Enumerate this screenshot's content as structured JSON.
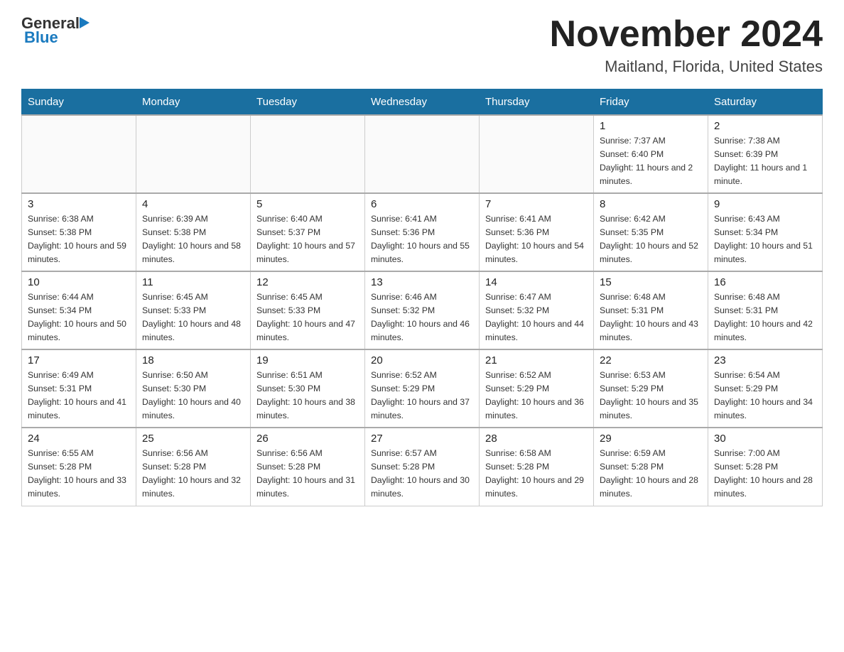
{
  "header": {
    "logo_general": "General",
    "logo_blue": "Blue",
    "month_title": "November 2024",
    "location": "Maitland, Florida, United States"
  },
  "days_of_week": [
    "Sunday",
    "Monday",
    "Tuesday",
    "Wednesday",
    "Thursday",
    "Friday",
    "Saturday"
  ],
  "weeks": [
    {
      "days": [
        {
          "num": "",
          "info": ""
        },
        {
          "num": "",
          "info": ""
        },
        {
          "num": "",
          "info": ""
        },
        {
          "num": "",
          "info": ""
        },
        {
          "num": "",
          "info": ""
        },
        {
          "num": "1",
          "info": "Sunrise: 7:37 AM\nSunset: 6:40 PM\nDaylight: 11 hours and 2 minutes."
        },
        {
          "num": "2",
          "info": "Sunrise: 7:38 AM\nSunset: 6:39 PM\nDaylight: 11 hours and 1 minute."
        }
      ]
    },
    {
      "days": [
        {
          "num": "3",
          "info": "Sunrise: 6:38 AM\nSunset: 5:38 PM\nDaylight: 10 hours and 59 minutes."
        },
        {
          "num": "4",
          "info": "Sunrise: 6:39 AM\nSunset: 5:38 PM\nDaylight: 10 hours and 58 minutes."
        },
        {
          "num": "5",
          "info": "Sunrise: 6:40 AM\nSunset: 5:37 PM\nDaylight: 10 hours and 57 minutes."
        },
        {
          "num": "6",
          "info": "Sunrise: 6:41 AM\nSunset: 5:36 PM\nDaylight: 10 hours and 55 minutes."
        },
        {
          "num": "7",
          "info": "Sunrise: 6:41 AM\nSunset: 5:36 PM\nDaylight: 10 hours and 54 minutes."
        },
        {
          "num": "8",
          "info": "Sunrise: 6:42 AM\nSunset: 5:35 PM\nDaylight: 10 hours and 52 minutes."
        },
        {
          "num": "9",
          "info": "Sunrise: 6:43 AM\nSunset: 5:34 PM\nDaylight: 10 hours and 51 minutes."
        }
      ]
    },
    {
      "days": [
        {
          "num": "10",
          "info": "Sunrise: 6:44 AM\nSunset: 5:34 PM\nDaylight: 10 hours and 50 minutes."
        },
        {
          "num": "11",
          "info": "Sunrise: 6:45 AM\nSunset: 5:33 PM\nDaylight: 10 hours and 48 minutes."
        },
        {
          "num": "12",
          "info": "Sunrise: 6:45 AM\nSunset: 5:33 PM\nDaylight: 10 hours and 47 minutes."
        },
        {
          "num": "13",
          "info": "Sunrise: 6:46 AM\nSunset: 5:32 PM\nDaylight: 10 hours and 46 minutes."
        },
        {
          "num": "14",
          "info": "Sunrise: 6:47 AM\nSunset: 5:32 PM\nDaylight: 10 hours and 44 minutes."
        },
        {
          "num": "15",
          "info": "Sunrise: 6:48 AM\nSunset: 5:31 PM\nDaylight: 10 hours and 43 minutes."
        },
        {
          "num": "16",
          "info": "Sunrise: 6:48 AM\nSunset: 5:31 PM\nDaylight: 10 hours and 42 minutes."
        }
      ]
    },
    {
      "days": [
        {
          "num": "17",
          "info": "Sunrise: 6:49 AM\nSunset: 5:31 PM\nDaylight: 10 hours and 41 minutes."
        },
        {
          "num": "18",
          "info": "Sunrise: 6:50 AM\nSunset: 5:30 PM\nDaylight: 10 hours and 40 minutes."
        },
        {
          "num": "19",
          "info": "Sunrise: 6:51 AM\nSunset: 5:30 PM\nDaylight: 10 hours and 38 minutes."
        },
        {
          "num": "20",
          "info": "Sunrise: 6:52 AM\nSunset: 5:29 PM\nDaylight: 10 hours and 37 minutes."
        },
        {
          "num": "21",
          "info": "Sunrise: 6:52 AM\nSunset: 5:29 PM\nDaylight: 10 hours and 36 minutes."
        },
        {
          "num": "22",
          "info": "Sunrise: 6:53 AM\nSunset: 5:29 PM\nDaylight: 10 hours and 35 minutes."
        },
        {
          "num": "23",
          "info": "Sunrise: 6:54 AM\nSunset: 5:29 PM\nDaylight: 10 hours and 34 minutes."
        }
      ]
    },
    {
      "days": [
        {
          "num": "24",
          "info": "Sunrise: 6:55 AM\nSunset: 5:28 PM\nDaylight: 10 hours and 33 minutes."
        },
        {
          "num": "25",
          "info": "Sunrise: 6:56 AM\nSunset: 5:28 PM\nDaylight: 10 hours and 32 minutes."
        },
        {
          "num": "26",
          "info": "Sunrise: 6:56 AM\nSunset: 5:28 PM\nDaylight: 10 hours and 31 minutes."
        },
        {
          "num": "27",
          "info": "Sunrise: 6:57 AM\nSunset: 5:28 PM\nDaylight: 10 hours and 30 minutes."
        },
        {
          "num": "28",
          "info": "Sunrise: 6:58 AM\nSunset: 5:28 PM\nDaylight: 10 hours and 29 minutes."
        },
        {
          "num": "29",
          "info": "Sunrise: 6:59 AM\nSunset: 5:28 PM\nDaylight: 10 hours and 28 minutes."
        },
        {
          "num": "30",
          "info": "Sunrise: 7:00 AM\nSunset: 5:28 PM\nDaylight: 10 hours and 28 minutes."
        }
      ]
    }
  ]
}
